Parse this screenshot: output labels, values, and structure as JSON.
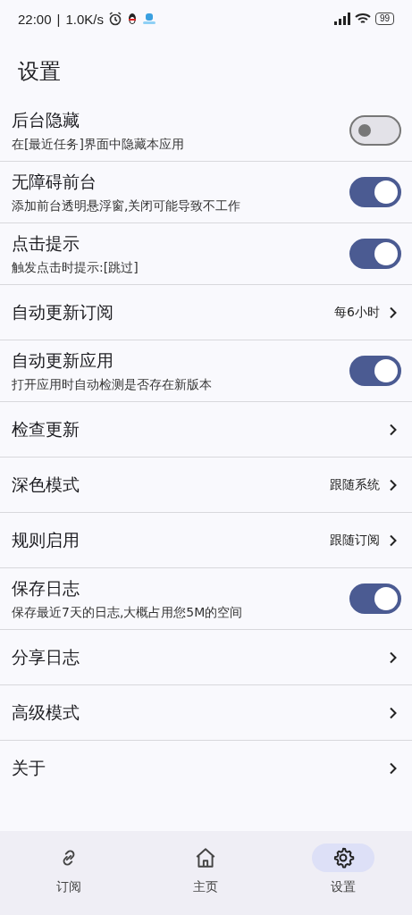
{
  "status_bar": {
    "time": "22:00",
    "separator": "|",
    "speed": "1.0K/s",
    "battery": "99"
  },
  "title": "设置",
  "settings": [
    {
      "kind": "toggle",
      "title": "后台隐藏",
      "subtitle": "在[最近任务]界面中隐藏本应用",
      "on": false
    },
    {
      "kind": "toggle",
      "title": "无障碍前台",
      "subtitle": "添加前台透明悬浮窗,关闭可能导致不工作",
      "on": true
    },
    {
      "kind": "toggle",
      "title": "点击提示",
      "subtitle": "触发点击时提示:[跳过]",
      "on": true
    },
    {
      "kind": "value",
      "title": "自动更新订阅",
      "value": "每6小时"
    },
    {
      "kind": "toggle",
      "title": "自动更新应用",
      "subtitle": "打开应用时自动检测是否存在新版本",
      "on": true
    },
    {
      "kind": "link",
      "title": "检查更新"
    },
    {
      "kind": "value",
      "title": "深色模式",
      "value": "跟随系统"
    },
    {
      "kind": "value",
      "title": "规则启用",
      "value": "跟随订阅"
    },
    {
      "kind": "toggle",
      "title": "保存日志",
      "subtitle": "保存最近7天的日志,大概占用您5M的空间",
      "on": true
    },
    {
      "kind": "link",
      "title": "分享日志"
    },
    {
      "kind": "link",
      "title": "高级模式"
    },
    {
      "kind": "link",
      "title": "关于"
    }
  ],
  "nav": [
    {
      "kind": "link",
      "label": "订阅",
      "selected": false
    },
    {
      "kind": "home",
      "label": "主页",
      "selected": false
    },
    {
      "kind": "gear",
      "label": "设置",
      "selected": true
    }
  ]
}
